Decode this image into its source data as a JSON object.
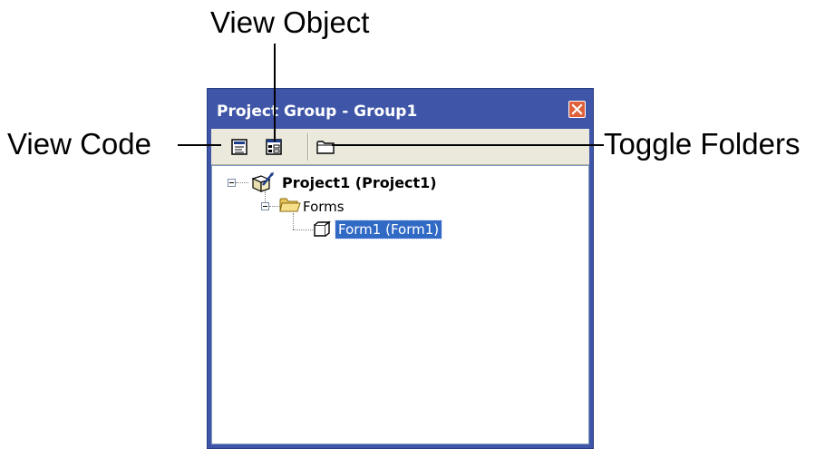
{
  "callouts": {
    "view_object": "View Object",
    "view_code": "View Code",
    "toggle_folders": "Toggle Folders"
  },
  "window": {
    "title": "Project Group - Group1",
    "close_icon": "close-icon"
  },
  "toolbar": {
    "buttons": [
      {
        "name": "view-code-button",
        "icon": "view-code-icon"
      },
      {
        "name": "view-object-button",
        "icon": "view-object-icon"
      },
      {
        "name": "toggle-folders-button",
        "icon": "folder-icon"
      }
    ]
  },
  "tree": {
    "project": {
      "label": "Project1 (Project1)",
      "icon": "project-icon",
      "expanded": true
    },
    "forms_folder": {
      "label": "Forms",
      "icon": "open-folder-icon",
      "expanded": true
    },
    "form": {
      "label": "Form1 (Form1)",
      "icon": "form-icon",
      "selected": true
    }
  },
  "colors": {
    "titlebar": "#3f56a8",
    "toolbar": "#ebe9dc",
    "selection": "#316ac5",
    "close_button": "#e0613a"
  }
}
